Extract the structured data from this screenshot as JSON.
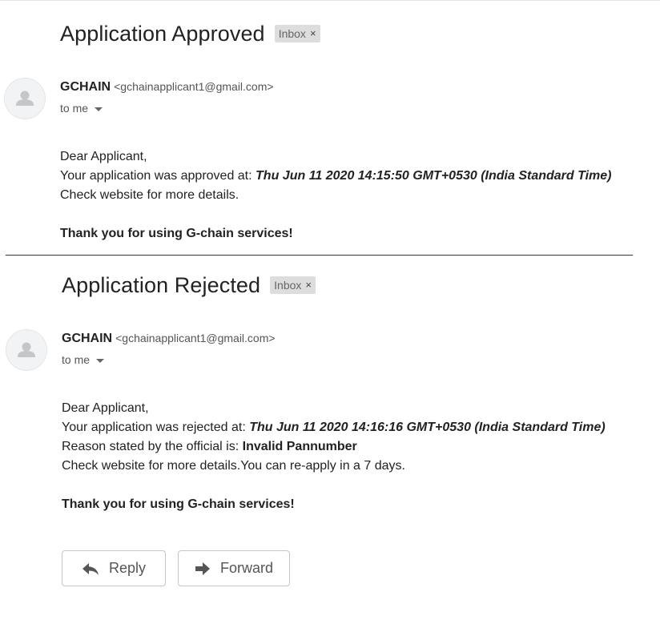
{
  "emails": [
    {
      "subject": "Application Approved",
      "label": "Inbox",
      "label_close": "×",
      "sender_name": "GCHAIN",
      "sender_email": "<gchainapplicant1@gmail.com>",
      "to": "to me",
      "greeting": "Dear Applicant,",
      "status_prefix": "Your application was approved at:",
      "timestamp": "Thu Jun 11 2020 14:15:50 GMT+0530 (India Standard Time)",
      "check_line": "Check website for more details.",
      "thanks": "Thank you for using G-chain services!"
    },
    {
      "subject": "Application Rejected",
      "label": "Inbox",
      "label_close": "×",
      "sender_name": "GCHAIN",
      "sender_email": "<gchainapplicant1@gmail.com>",
      "to": "to me",
      "greeting": "Dear Applicant,",
      "status_prefix": "Your application was rejected at:",
      "timestamp": "Thu Jun 11 2020 14:16:16 GMT+0530 (India Standard Time)",
      "reason_prefix": "Reason stated by the official is:",
      "reason": "Invalid Pannumber",
      "check_line": "Check website for more details.You can re-apply in a 7 days.",
      "thanks": "Thank you for using G-chain services!"
    }
  ],
  "actions": {
    "reply_label": "Reply",
    "reply_icon": "reply-arrow-icon",
    "forward_label": "Forward",
    "forward_icon": "forward-arrow-icon"
  },
  "colors": {
    "label_bg": "#dddddd",
    "text": "#222222",
    "muted": "#555555",
    "avatar_bg": "#f1f3f4"
  }
}
